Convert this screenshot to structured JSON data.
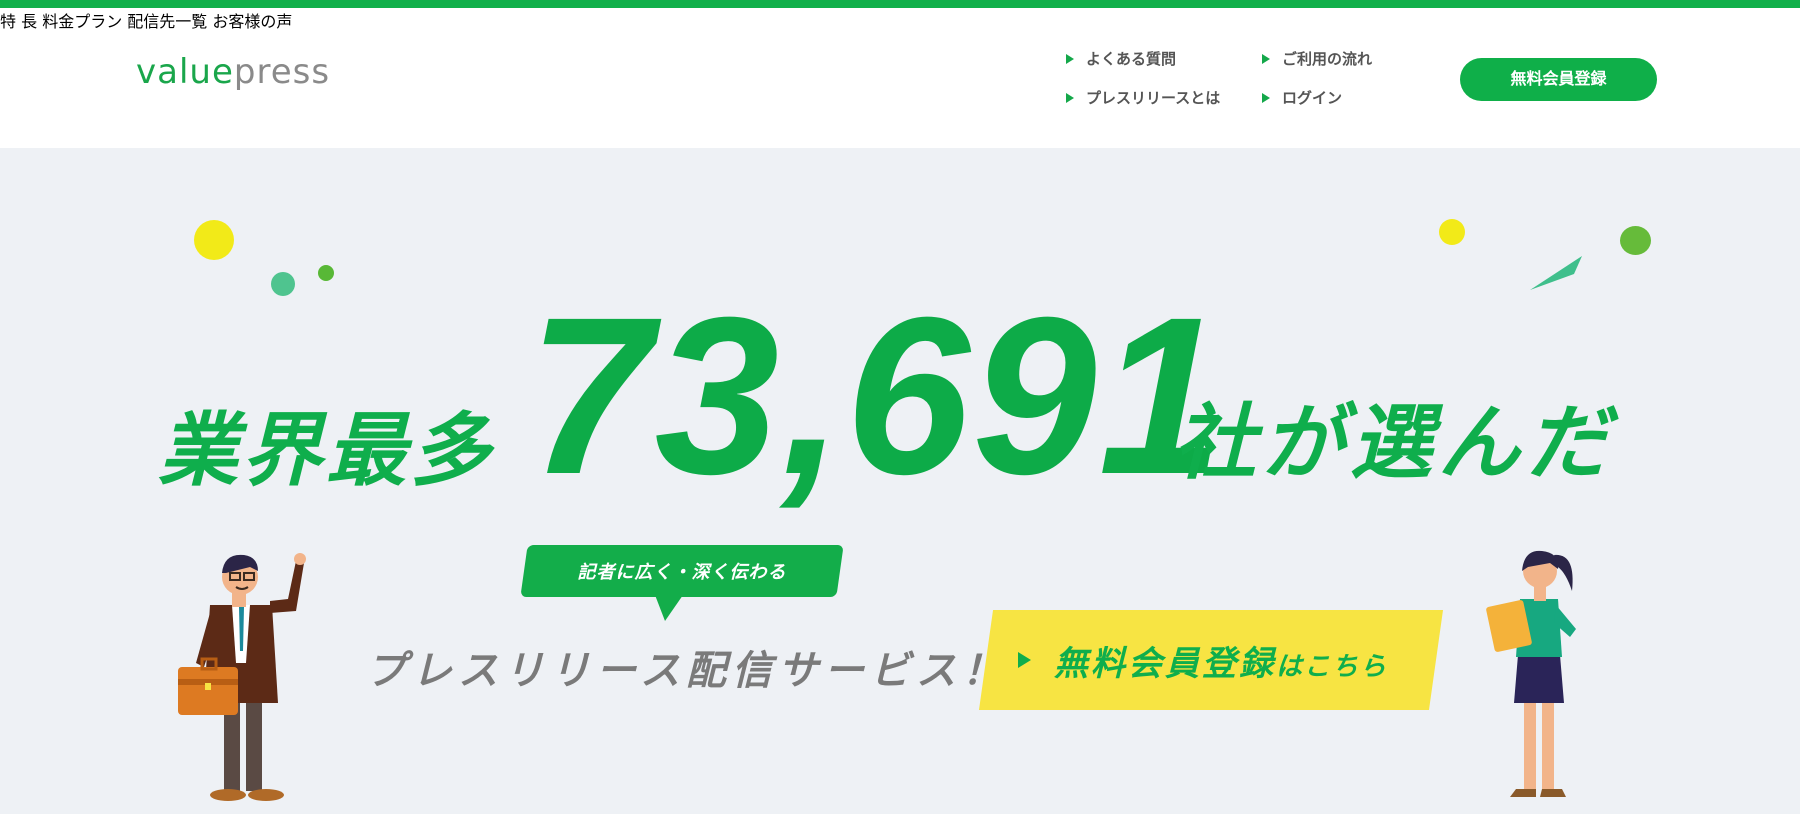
{
  "brand": {
    "logo_part1": "value",
    "logo_part2": "press"
  },
  "nav": {
    "main": [
      "特 長",
      "料金プラン",
      "配信先一覧",
      "お客様の声"
    ],
    "sub": [
      "よくある質問",
      "ご利用の流れ",
      "プレスリリースとは",
      "ログイン"
    ],
    "register_button": "無料会員登録"
  },
  "hero": {
    "headline_left": "業界最多",
    "headline_number": "73,691",
    "headline_right": "社が選んだ",
    "bubble": "記者に広く・深く伝わる",
    "service": "プレスリリース配信サービス！",
    "cta_main": "無料会員登録",
    "cta_suffix": "はこちら"
  },
  "colors": {
    "brand_green": "#11b04a",
    "cta_yellow": "#f7e443",
    "hero_bg": "#eef1f5"
  },
  "icons": [
    "triangle-arrow-icon",
    "businessman-illustration",
    "businesswoman-illustration"
  ]
}
